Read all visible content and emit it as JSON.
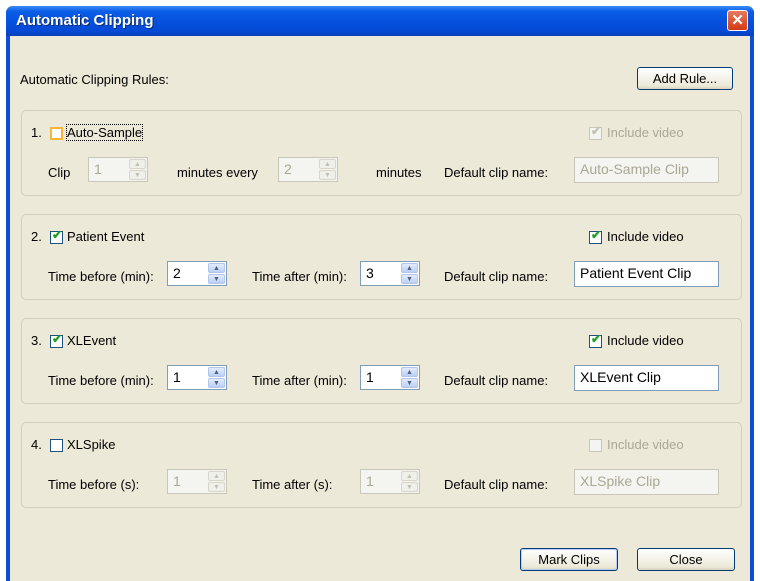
{
  "window": {
    "title": "Automatic Clipping",
    "close_glyph": "✕"
  },
  "header": {
    "rules_label": "Automatic Clipping Rules:",
    "add_rule_button": "Add Rule..."
  },
  "rules": [
    {
      "number": "1.",
      "name": "Auto-Sample",
      "enabled": false,
      "include_video_label": "Include video",
      "include_video_checked": true,
      "include_video_disabled": true,
      "row_label_1": "Clip",
      "spin_1": "1",
      "row_label_2": "minutes every",
      "spin_2": "2",
      "row_label_3": "minutes",
      "default_clip_label": "Default clip name:",
      "default_clip_name": "Auto-Sample Clip"
    },
    {
      "number": "2.",
      "name": "Patient Event",
      "enabled": true,
      "include_video_label": "Include video",
      "include_video_checked": true,
      "before_label": "Time before (min):",
      "before_value": "2",
      "after_label": "Time after (min):",
      "after_value": "3",
      "default_clip_label": "Default clip name:",
      "default_clip_name": "Patient Event Clip"
    },
    {
      "number": "3.",
      "name": "XLEvent",
      "enabled": true,
      "include_video_label": "Include video",
      "include_video_checked": true,
      "before_label": "Time before (min):",
      "before_value": "1",
      "after_label": "Time after (min):",
      "after_value": "1",
      "default_clip_label": "Default clip name:",
      "default_clip_name": "XLEvent Clip"
    },
    {
      "number": "4.",
      "name": "XLSpike",
      "enabled": false,
      "include_video_label": "Include video",
      "include_video_checked": false,
      "include_video_disabled": true,
      "before_label": "Time before (s):",
      "before_value": "1",
      "after_label": "Time after (s):",
      "after_value": "1",
      "default_clip_label": "Default clip name:",
      "default_clip_name": "XLSpike Clip"
    }
  ],
  "footer": {
    "mark_clips_button": "Mark Clips",
    "close_button": "Close"
  },
  "icons": {
    "spin_up": "▲",
    "spin_down": "▼",
    "check": "✔"
  },
  "colors": {
    "title_bar": "#0552de",
    "dialog_face": "#ece9d8",
    "checkmark": "#21a121",
    "disabled_text": "#a9a894"
  }
}
